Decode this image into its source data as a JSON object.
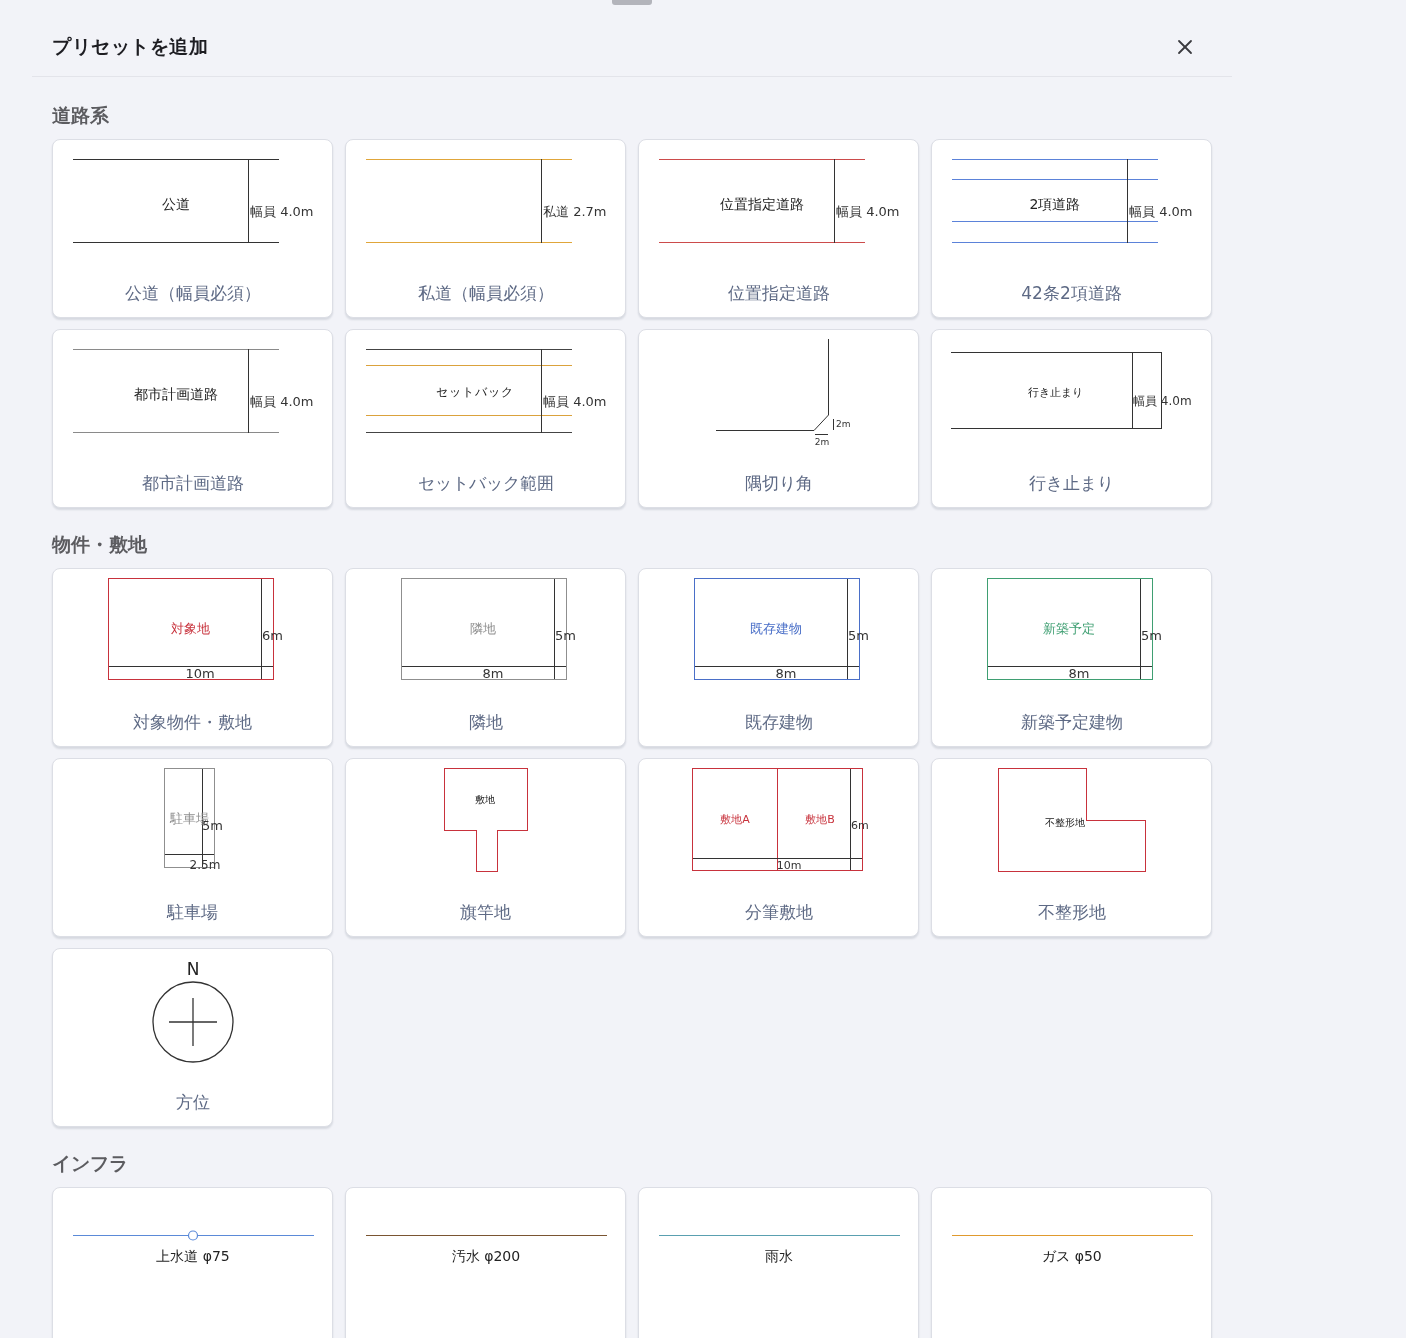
{
  "header": {
    "title": "プリセットを追加"
  },
  "sections": [
    {
      "title": "道路系",
      "presets": [
        {
          "kind": "road",
          "label": "公道（幅員必須）",
          "name": "公道",
          "width_label": "幅員 4.0m",
          "color": "#333333"
        },
        {
          "kind": "road",
          "label": "私道（幅員必須）",
          "width_label": "私道 2.7m",
          "color": "#e0a63a"
        },
        {
          "kind": "road",
          "label": "位置指定道路",
          "name": "位置指定道路",
          "width_label": "幅員 4.0m",
          "color": "#cc4b4b"
        },
        {
          "kind": "narrow_road",
          "label": "42条2項道路",
          "name": "2項道路",
          "width_label": "幅員 4.0m",
          "color": "#5b82d9"
        },
        {
          "kind": "road",
          "label": "都市計画道路",
          "name": "都市計画道路",
          "width_label": "幅員 4.0m",
          "color": "#8a8a8a"
        },
        {
          "kind": "setback",
          "label": "セットバック範囲",
          "name": "セットバック",
          "width_label": "幅員 4.0m",
          "color": "#dba23c"
        },
        {
          "kind": "corner_cut",
          "label": "隅切り角",
          "leg_labels": [
            "2m",
            "2m"
          ]
        },
        {
          "kind": "dead_end",
          "label": "行き止まり",
          "name": "行き止まり",
          "width_label": "幅員 4.0m"
        }
      ]
    },
    {
      "title": "物件・敷地",
      "presets": [
        {
          "kind": "lot",
          "label": "対象物件・敷地",
          "name": "対象地",
          "depth_label": "6m",
          "frontage_label": "10m",
          "color": "#c8323c"
        },
        {
          "kind": "lot",
          "label": "隣地",
          "name": "隣地",
          "depth_label": "5m",
          "frontage_label": "8m",
          "color": "#8f8f8f"
        },
        {
          "kind": "lot",
          "label": "既存建物",
          "name": "既存建物",
          "depth_label": "5m",
          "frontage_label": "8m",
          "color": "#4a6fc8"
        },
        {
          "kind": "lot",
          "label": "新築予定建物",
          "name": "新築予定",
          "depth_label": "5m",
          "frontage_label": "8m",
          "color": "#3f9f72"
        },
        {
          "kind": "parking",
          "label": "駐車場",
          "name": "駐車場",
          "depth_label": "5m",
          "frontage_label": "2.5m",
          "color": "#8f8f8f"
        },
        {
          "kind": "flag_lot",
          "label": "旗竿地",
          "name": "敷地",
          "color": "#c8323c"
        },
        {
          "kind": "split_lot",
          "label": "分筆敷地",
          "names": [
            "敷地A",
            "敷地B"
          ],
          "depth_label": "6m",
          "frontage_label": "10m",
          "color": "#c8323c"
        },
        {
          "kind": "irregular_lot",
          "label": "不整形地",
          "name": "不整形地",
          "color": "#c8323c"
        },
        {
          "kind": "compass",
          "label": "方位",
          "north_label": "N"
        }
      ]
    },
    {
      "title": "インフラ",
      "presets": [
        {
          "kind": "pipe",
          "name": "上水道 φ75",
          "color": "#5b8ad8",
          "valve": true
        },
        {
          "kind": "pipe",
          "name": "汚水 φ200",
          "color": "#7a5532",
          "valve": false
        },
        {
          "kind": "pipe",
          "name": "雨水",
          "color": "#5aa0b0",
          "valve": false
        },
        {
          "kind": "pipe",
          "name": "ガス φ50",
          "color": "#e09a2e",
          "valve": false
        }
      ]
    }
  ]
}
